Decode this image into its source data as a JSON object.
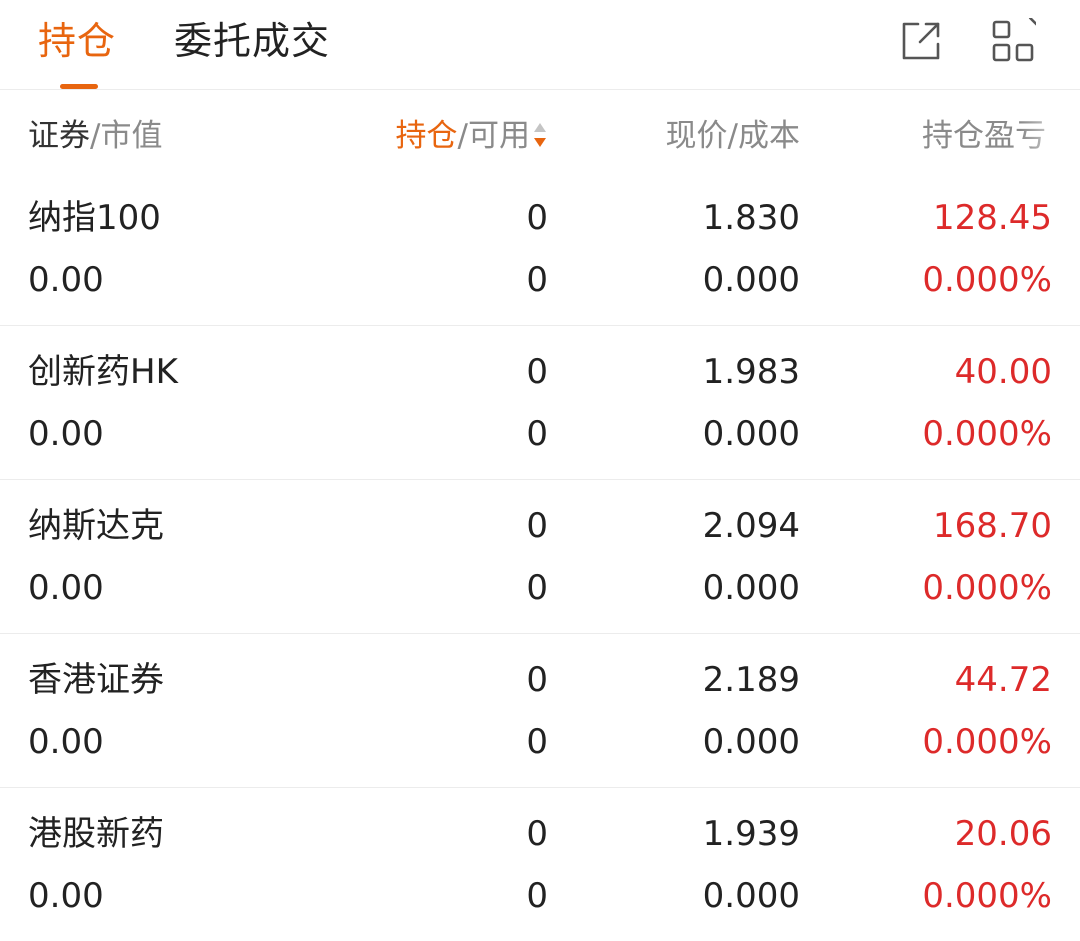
{
  "tabs": [
    {
      "label": "持仓",
      "active": true
    },
    {
      "label": "委托成交",
      "active": false
    }
  ],
  "toolbar": {
    "icons": [
      "external-link-icon",
      "grid-icon"
    ]
  },
  "colors": {
    "accent": "#e8650f",
    "profit": "#dd2a2a",
    "muted": "#8a8a8a",
    "text": "#222222"
  },
  "columns": {
    "security": {
      "primary": "证券",
      "sep": "/",
      "secondary": "市值"
    },
    "position": {
      "primary": "持仓",
      "sep": "/",
      "secondary": "可用"
    },
    "price": "现价/成本",
    "pl": "持仓盈亏"
  },
  "rows": [
    {
      "name": "纳指100",
      "market_value": "0.00",
      "position": "0",
      "available": "0",
      "price": "1.830",
      "cost": "0.000",
      "pl": "128.45",
      "pl_pct": "0.000%"
    },
    {
      "name": "创新药HK",
      "market_value": "0.00",
      "position": "0",
      "available": "0",
      "price": "1.983",
      "cost": "0.000",
      "pl": "40.00",
      "pl_pct": "0.000%"
    },
    {
      "name": "纳斯达克",
      "market_value": "0.00",
      "position": "0",
      "available": "0",
      "price": "2.094",
      "cost": "0.000",
      "pl": "168.70",
      "pl_pct": "0.000%"
    },
    {
      "name": "香港证券",
      "market_value": "0.00",
      "position": "0",
      "available": "0",
      "price": "2.189",
      "cost": "0.000",
      "pl": "44.72",
      "pl_pct": "0.000%"
    },
    {
      "name": "港股新药",
      "market_value": "0.00",
      "position": "0",
      "available": "0",
      "price": "1.939",
      "cost": "0.000",
      "pl": "20.06",
      "pl_pct": "0.000%"
    }
  ]
}
